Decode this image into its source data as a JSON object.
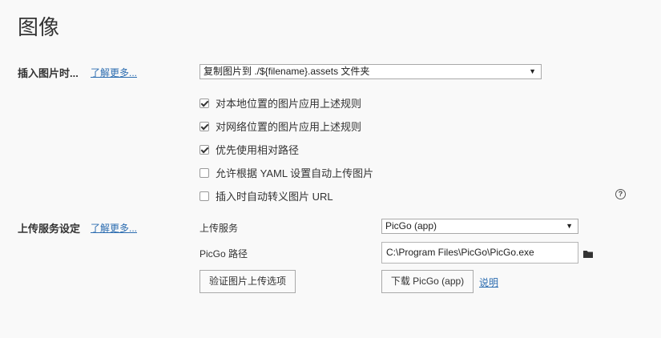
{
  "page": {
    "title": "图像"
  },
  "insert_section": {
    "label": "插入图片时...",
    "learn_more": "了解更多...",
    "action_select": {
      "value": "复制图片到 ./${filename}.assets 文件夹"
    },
    "options": [
      {
        "label": "对本地位置的图片应用上述规则",
        "checked": true
      },
      {
        "label": "对网络位置的图片应用上述规则",
        "checked": true
      },
      {
        "label": "优先使用相对路径",
        "checked": true
      },
      {
        "label": "允许根据 YAML 设置自动上传图片",
        "checked": false
      },
      {
        "label": "插入时自动转义图片 URL",
        "checked": false
      }
    ],
    "help_icon": "?"
  },
  "upload_section": {
    "label": "上传服务设定",
    "learn_more": "了解更多...",
    "service_label": "上传服务",
    "service_select": {
      "value": "PicGo (app)"
    },
    "path_label": "PicGo 路径",
    "path_value": "C:\\Program Files\\PicGo\\PicGo.exe",
    "folder_icon": "folder-icon",
    "verify_button": "验证图片上传选项",
    "download_button": "下载 PicGo (app)",
    "explain_link": "说明"
  }
}
